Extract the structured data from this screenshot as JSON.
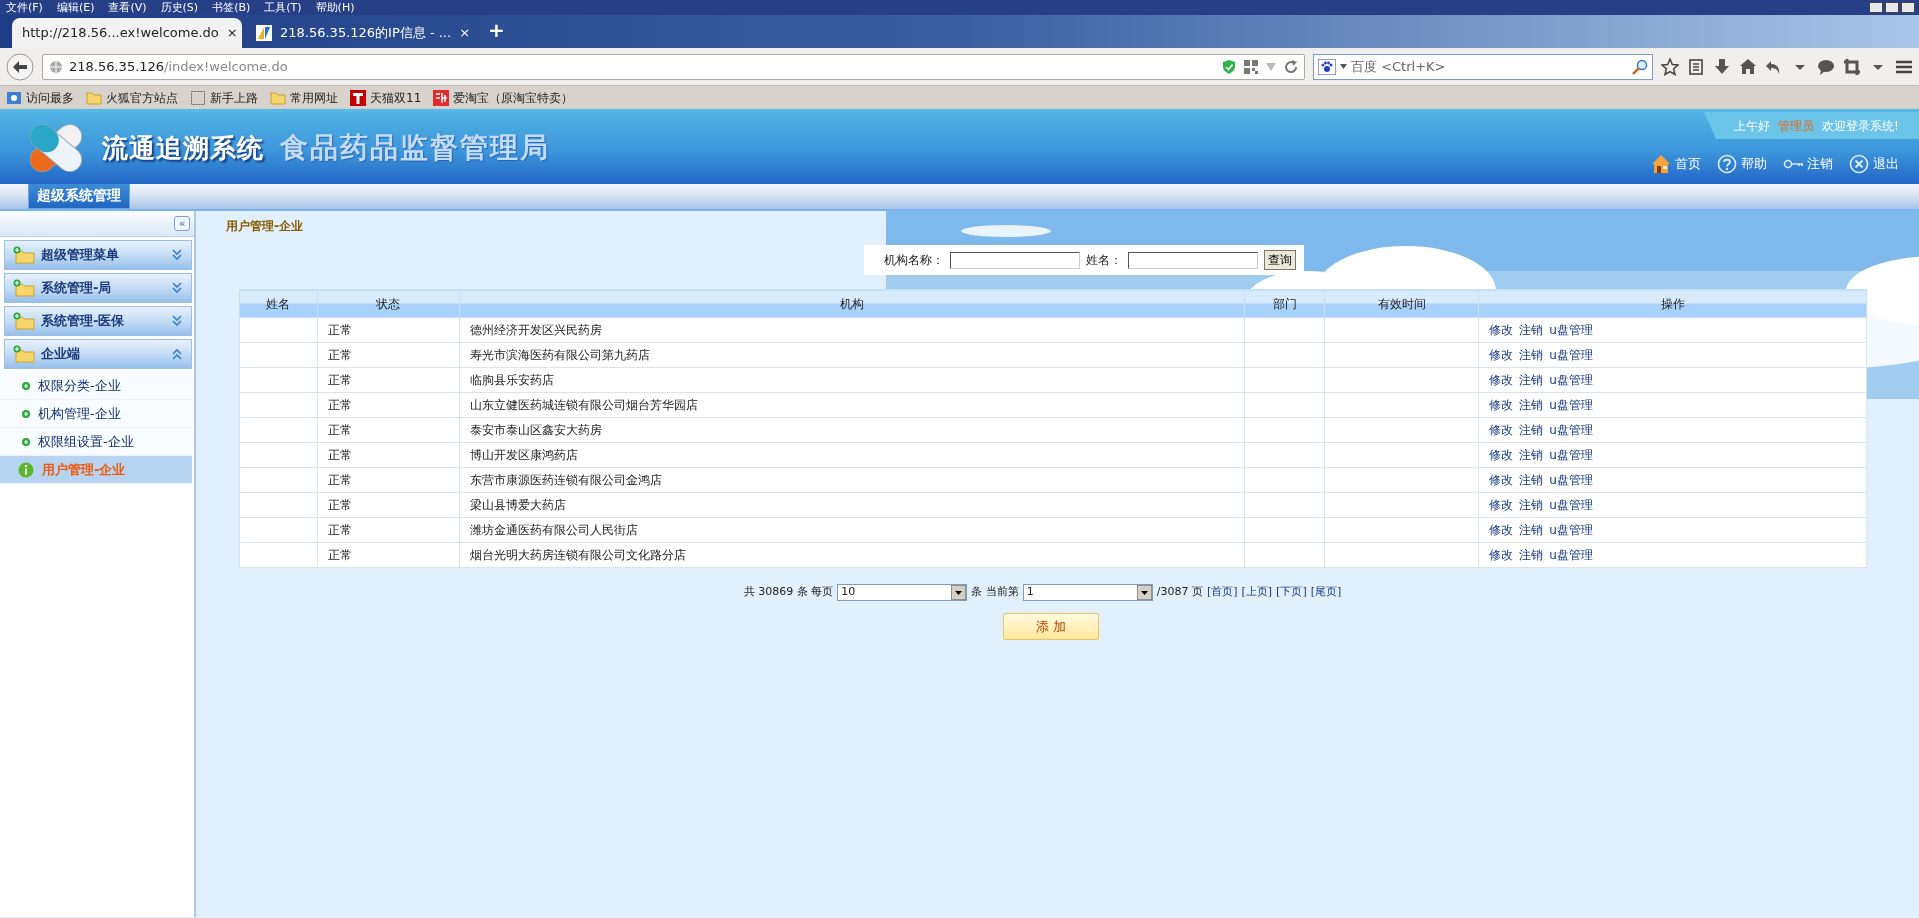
{
  "browser": {
    "menu": [
      "文件(F)",
      "编辑(E)",
      "查看(V)",
      "历史(S)",
      "书签(B)",
      "工具(T)",
      "帮助(H)"
    ],
    "tabs": [
      {
        "title": "http://218.56...ex!welcome.do",
        "close": "×",
        "selected": true
      },
      {
        "title": "218.56.35.126的IP信息 - ...",
        "close": "×",
        "selected": false
      }
    ],
    "new_tab": "+",
    "url": {
      "host": "218.56.35.126",
      "path": "/index!welcome.do"
    },
    "search_placeholder": "百度 <Ctrl+K>",
    "bookmarks": [
      {
        "label": "访问最多",
        "kind": "smart"
      },
      {
        "label": "火狐官方站点",
        "kind": "folder"
      },
      {
        "label": "新手上路",
        "kind": "blank"
      },
      {
        "label": "常用网址",
        "kind": "folder"
      },
      {
        "label": "天猫双11",
        "kind": "tmall"
      },
      {
        "label": "爱淘宝（原淘宝特卖）",
        "kind": "taobao"
      }
    ]
  },
  "app": {
    "title": "流通追溯系统",
    "subtitle": "食品药品监督管理局",
    "greeting": "上午好",
    "user": "管理员",
    "welcome": "欢迎登录系统!",
    "header_links": [
      {
        "label": "首页",
        "kind": "home"
      },
      {
        "label": "帮助",
        "kind": "help"
      },
      {
        "label": "注销",
        "kind": "key"
      },
      {
        "label": "退出",
        "kind": "exit"
      }
    ],
    "nav_tabs": [
      {
        "label": "超级系统管理",
        "selected": true
      }
    ]
  },
  "sidebar": {
    "collapse": "«",
    "groups": [
      {
        "label": "超级管理菜单",
        "expanded": false
      },
      {
        "label": "系统管理-局",
        "expanded": false
      },
      {
        "label": "系统管理-医保",
        "expanded": false
      },
      {
        "label": "企业端",
        "expanded": true,
        "children": [
          {
            "label": "权限分类-企业",
            "selected": false
          },
          {
            "label": "机构管理-企业",
            "selected": false
          },
          {
            "label": "权限组设置-企业",
            "selected": false
          },
          {
            "label": "用户管理-企业",
            "selected": true
          }
        ]
      }
    ]
  },
  "breadcrumb": "用户管理-企业",
  "search": {
    "fields": [
      {
        "label": "机构名称："
      },
      {
        "label": "姓名："
      }
    ],
    "button": "查询"
  },
  "table": {
    "columns": [
      "姓名",
      "状态",
      "机构",
      "部门",
      "有效时间",
      "操作"
    ],
    "rows": [
      {
        "status": "正常",
        "org": "德州经济开发区兴民药房",
        "actions": [
          "修改",
          "注销",
          "u盘管理"
        ]
      },
      {
        "status": "正常",
        "org": "寿光市滨海医药有限公司第九药店",
        "actions": [
          "修改",
          "注销",
          "u盘管理"
        ]
      },
      {
        "status": "正常",
        "org": "临朐县乐安药店",
        "actions": [
          "修改",
          "注销",
          "u盘管理"
        ]
      },
      {
        "status": "正常",
        "org": "山东立健医药城连锁有限公司烟台芳华园店",
        "actions": [
          "修改",
          "注销",
          "u盘管理"
        ]
      },
      {
        "status": "正常",
        "org": "泰安市泰山区鑫安大药房",
        "actions": [
          "修改",
          "注销",
          "u盘管理"
        ]
      },
      {
        "status": "正常",
        "org": "博山开发区康鸿药店",
        "actions": [
          "修改",
          "注销",
          "u盘管理"
        ]
      },
      {
        "status": "正常",
        "org": "东营市康源医药连锁有限公司金鸿店",
        "actions": [
          "修改",
          "注销",
          "u盘管理"
        ]
      },
      {
        "status": "正常",
        "org": "梁山县博爱大药店",
        "actions": [
          "修改",
          "注销",
          "u盘管理"
        ]
      },
      {
        "status": "正常",
        "org": "潍坊金通医药有限公司人民街店",
        "actions": [
          "修改",
          "注销",
          "u盘管理"
        ]
      },
      {
        "status": "正常",
        "org": "烟台光明大药房连锁有限公司文化路分店",
        "actions": [
          "修改",
          "注销",
          "u盘管理"
        ]
      }
    ]
  },
  "pagination": {
    "total_text": "共 30869 条 每页",
    "per_page": "10",
    "page_text": "条 当前第",
    "page": "1",
    "pages_text": "/3087 页",
    "links": [
      "[首页]",
      "[上页]",
      "[下页]",
      "[尾页]"
    ]
  },
  "add_button": "添 加"
}
